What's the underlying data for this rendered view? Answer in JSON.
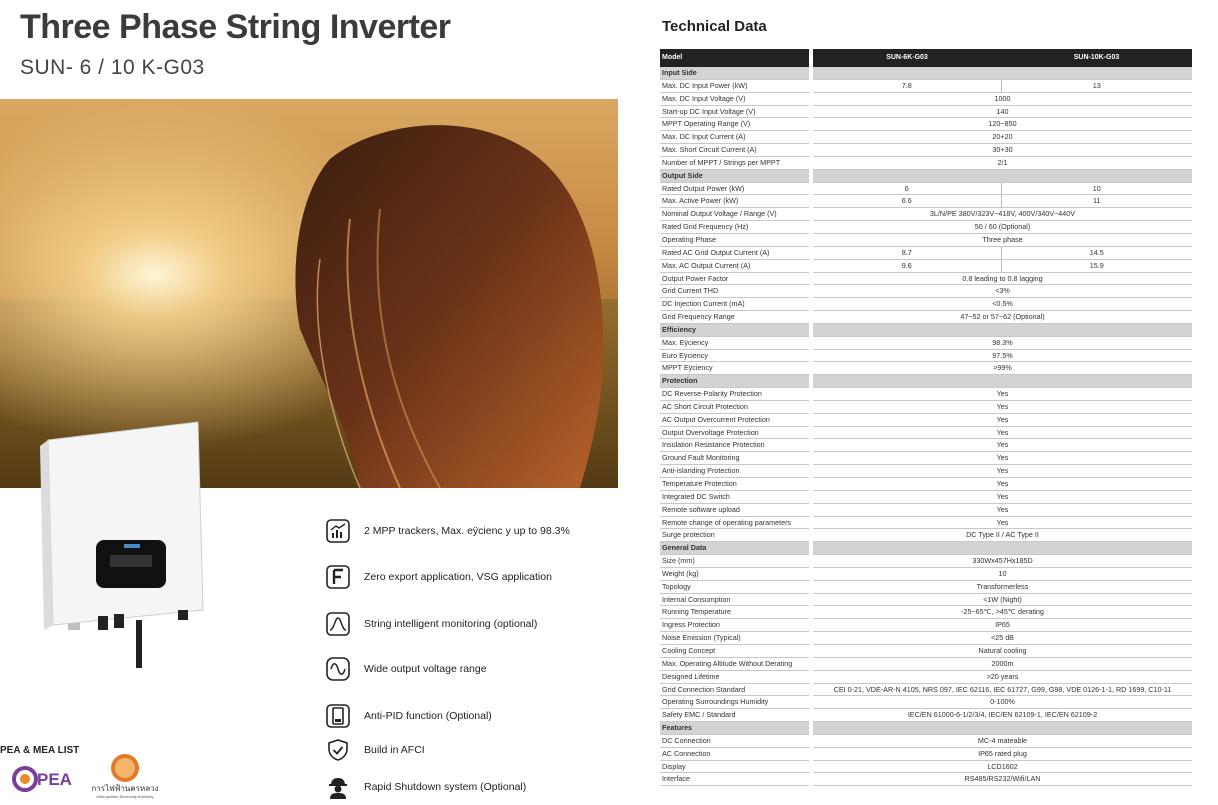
{
  "header": {
    "title": "Three Phase String Inverter",
    "subtitle": "SUN- 6 / 10 K-G03"
  },
  "features": [
    {
      "icon": "efficiency-chart-icon",
      "label": "2 MPP trackers, Max. eÿcienc  y up to 98.3%"
    },
    {
      "icon": "f-letter-icon",
      "label": "Zero export application, VSG application"
    },
    {
      "icon": "monitoring-curve-icon",
      "label": "String intelligent monitoring (optional)"
    },
    {
      "icon": "sine-wave-icon",
      "label": "Wide output voltage range"
    },
    {
      "icon": "anti-pid-icon",
      "label": "Anti-PID function (Optional)"
    },
    {
      "icon": "shield-check-icon",
      "label": "Build in AFCI"
    },
    {
      "icon": "worker-icon",
      "label": "Rapid Shutdown system (Optional)"
    }
  ],
  "certification": {
    "label": "PEA & MEA LIST",
    "pea_logo_text": "PEA",
    "mea_logo_text": "การไฟฟ้านครหลวง",
    "mea_logo_subtext": "Metropolitan Electricity Authority"
  },
  "technical": {
    "title": "Technical Data",
    "header": {
      "label": "Model",
      "col1": "SUN-6K-G03",
      "col2": "SUN-10K-G03"
    },
    "rows": [
      {
        "type": "section",
        "label": "Input Side"
      },
      {
        "label": "Max. DC Input Power (kW)",
        "v1": "7.8",
        "v2": "13"
      },
      {
        "label": "Max. DC Input Voltage (V)",
        "v": "1000"
      },
      {
        "label": "Start-up DC Input Voltage (V)",
        "v": "140"
      },
      {
        "label": "MPPT  Operating Range (V)",
        "v": "120~850"
      },
      {
        "label": "Max. DC Input Current (A)",
        "v": "20+20"
      },
      {
        "label": "Max. Short Circuit Current (A)",
        "v": "30+30"
      },
      {
        "label": "Number of MPPT / Strings per MPPT",
        "v": "2/1"
      },
      {
        "type": "section",
        "label": "Output Side"
      },
      {
        "label": "Rated Output Power (kW)",
        "v1": "6",
        "v2": "10"
      },
      {
        "label": "Max. Active Power (kW)",
        "v1": "6.6",
        "v2": "11"
      },
      {
        "label": "Nominal Output Voltage / Range (V)",
        "v": "3L/N/PE  380V/323V~418V, 400V/340V~440V"
      },
      {
        "label": "Rated Grid Frequency (Hz)",
        "v": "50 / 60 (Optional)"
      },
      {
        "label": "Operating Phase",
        "v": "Three phase"
      },
      {
        "label": "Rated AC Grid Output Current (A)",
        "v1": "8.7",
        "v2": "14.5"
      },
      {
        "label": "Max. AC Output Current (A)",
        "v1": "9.6",
        "v2": "15.9"
      },
      {
        "label": "Output Power Factor",
        "v": "0.8 leading to 0.8 lagging"
      },
      {
        "label": "Grid Current THD",
        "v": "<3%"
      },
      {
        "label": "DC Injection Current (mA)",
        "v": "<0.5%"
      },
      {
        "label": "Grid Frequency Range",
        "v": "47~52 or 57~62 (Optional)"
      },
      {
        "type": "section",
        "label": "Efficiency"
      },
      {
        "label": "Max. Eÿciency",
        "v": "98.3%"
      },
      {
        "label": "Euro Eÿciency",
        "v": "97.5%"
      },
      {
        "label": "MPPT Eÿciency",
        "v": ">99%"
      },
      {
        "type": "section",
        "label": "Protection"
      },
      {
        "label": "DC Reverse-Polarity Protection",
        "v": "Yes"
      },
      {
        "label": "AC Short Circuit Protection",
        "v": "Yes"
      },
      {
        "label": "AC Output Overcurrent Protection",
        "v": "Yes"
      },
      {
        "label": "Output Overvoltage Protection",
        "v": "Yes"
      },
      {
        "label": "Insulation Resistance Protection",
        "v": "Yes"
      },
      {
        "label": "Ground Fault Monitoring",
        "v": "Yes"
      },
      {
        "label": "Anti-islanding Protection",
        "v": "Yes"
      },
      {
        "label": "Temperature Protection",
        "v": "Yes"
      },
      {
        "label": "Integrated DC Switch",
        "v": "Yes"
      },
      {
        "label": "Remote software upload",
        "v": "Yes"
      },
      {
        "label": "Remote change of operating parameters",
        "v": "Yes"
      },
      {
        "label": "Surge protection",
        "v": "DC Type II / AC Type II"
      },
      {
        "type": "section",
        "label": "General Data"
      },
      {
        "label": "Size (mm)",
        "v": "330Wx457Hx185D"
      },
      {
        "label": "Weight (kg)",
        "v": "10"
      },
      {
        "label": "Topology",
        "v": "Transformerless"
      },
      {
        "label": "Internal Consumption",
        "v": "<1W (Night)"
      },
      {
        "label": "Running Temperature",
        "v": "-25~65℃, >45℃ derating"
      },
      {
        "label": "Ingress Protection",
        "v": "IP65"
      },
      {
        "label": "Noise Emission (Typical)",
        "v": "<25 dB"
      },
      {
        "label": "Cooling Concept",
        "v": "Natural cooling"
      },
      {
        "label": "Max. Operating Altitude Without Derating",
        "v": "2000m"
      },
      {
        "label": "Designed Lifetime",
        "v": ">20 years"
      },
      {
        "label": "Grid Connection Standard",
        "v": "CEI 0-21, VDE-AR-N 4105, NRS 097, IEC 62116, IEC 61727, G99, G98, VDE 0126-1-1, RD 1699, C10-11"
      },
      {
        "label": "Operating Surroundings Humidity",
        "v": "0-100%"
      },
      {
        "label": "Safety EMC / Standard",
        "v": "IEC/EN 61000-6-1/2/3/4, IEC/EN 62109-1, IEC/EN 62109-2"
      },
      {
        "type": "section",
        "label": "Features"
      },
      {
        "label": "DC Connection",
        "v": "MC-4 mateable"
      },
      {
        "label": "AC Connection",
        "v": "IP65 rated plug"
      },
      {
        "label": "Display",
        "v": "LCD1602"
      },
      {
        "label": "Interface",
        "v": "RS485/RS232/Wifi/LAN"
      }
    ]
  }
}
